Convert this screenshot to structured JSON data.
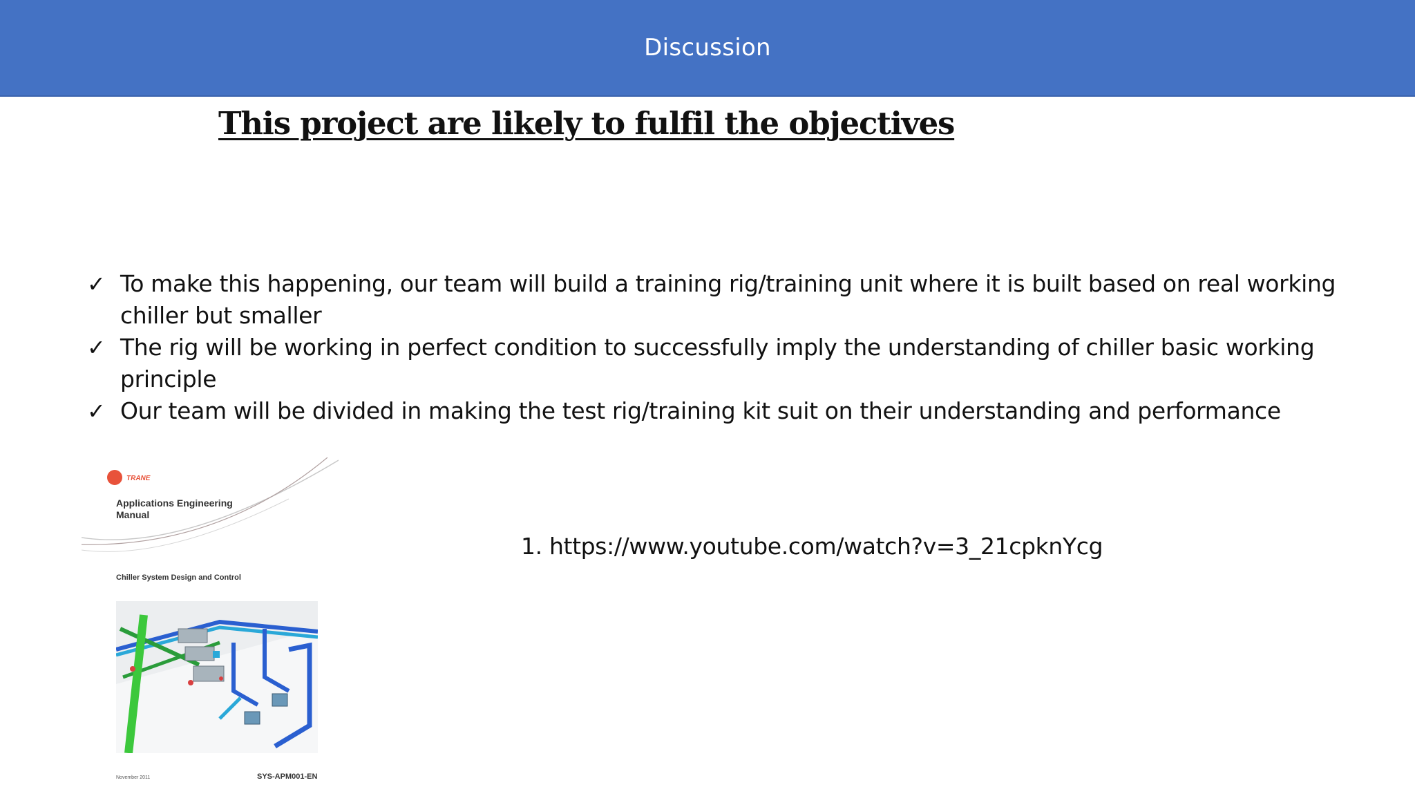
{
  "header": {
    "title": "Discussion"
  },
  "main": {
    "title": "This project are likely to fulfil the objectives",
    "bullets": [
      {
        "icon": "check-icon",
        "text": "To make this happening, our team will build a training rig/training unit where it is built based on real working chiller but smaller"
      },
      {
        "icon": "check-icon",
        "text": "The rig will be working in perfect condition to successfully imply the understanding of chiller basic working principle"
      },
      {
        "icon": "check-icon",
        "text": "Our team will be divided in making the test rig/training kit suit on their understanding and performance"
      }
    ],
    "references": [
      {
        "number": "1.",
        "url": "https://www.youtube.com/watch?v=3_21cpknYcg"
      }
    ]
  },
  "manual_cover": {
    "logo_text": "TRANE",
    "heading": "Applications Engineering Manual",
    "subtitle": "Chiller System Design and Control",
    "date": "November 2011",
    "code": "SYS-APM001-EN",
    "colors": {
      "logo": "#e8523a",
      "pipe_green": "#3cc83c",
      "pipe_blue": "#2a5fd0",
      "pipe_cyan": "#2aa8d8"
    }
  },
  "theme": {
    "header_bg": "#4472c4",
    "header_text": "#ffffff",
    "body_text": "#111111"
  }
}
